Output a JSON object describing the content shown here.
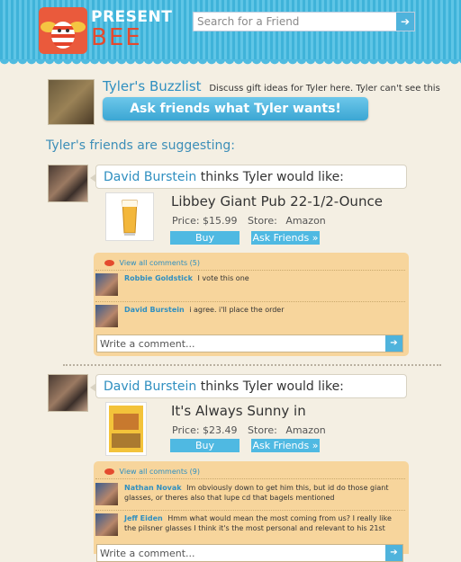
{
  "header": {
    "logo_top": "PRESENT",
    "logo_bottom": "BEE",
    "search_placeholder": "Search for a Friend",
    "search_button_icon": "arrow-right-icon",
    "search_button_glyph": "➔"
  },
  "profile": {
    "buzzlist_title": "Tyler's Buzzlist",
    "buzzlist_desc": "Discuss gift ideas for Tyler here. Tyler can't see this page.",
    "ask_button": "Ask friends what Tyler wants!"
  },
  "section_heading": "Tyler's friends are suggesting:",
  "suggestions": [
    {
      "suggester": "David Burstein",
      "suffix": "thinks Tyler would like:",
      "product_name": "Libbey Giant Pub 22-1/2-Ounce",
      "price_label": "Price: $15.99",
      "store_label": "Store:",
      "store": "Amazon",
      "buy_label": "Buy",
      "ask_label": "Ask Friends »",
      "view_comments": "View all comments (5)",
      "comments": [
        {
          "name": "Robbie Goldstick",
          "text": "I vote this one"
        },
        {
          "name": "David Burstein",
          "text": "i agree. i'll place the order"
        }
      ],
      "comment_placeholder": "Write a comment...",
      "send_glyph": "➔"
    },
    {
      "suggester": "David Burstein",
      "suffix": "thinks Tyler would like:",
      "product_name": "It's Always Sunny in",
      "price_label": "Price: $23.49",
      "store_label": "Store:",
      "store": "Amazon",
      "buy_label": "Buy",
      "ask_label": "Ask Friends »",
      "view_comments": "View all comments (9)",
      "comments": [
        {
          "name": "Nathan Novak",
          "text": "Im obviously down to get him this, but id do those giant glasses, or theres also that lupe cd that bagels mentioned"
        },
        {
          "name": "Jeff Eiden",
          "text": "Hmm what would mean the most coming from us? I really like the pilsner glasses I think it's the most personal and relevant to his 21st"
        }
      ],
      "comment_placeholder": "Write a comment...",
      "send_glyph": "➔"
    }
  ],
  "colors": {
    "header_blue": "#4fbbe0",
    "link_blue": "#2f8fc0",
    "logo_red": "#ea5a3c",
    "comment_panel": "#f7d59c",
    "background": "#f4efe3"
  }
}
